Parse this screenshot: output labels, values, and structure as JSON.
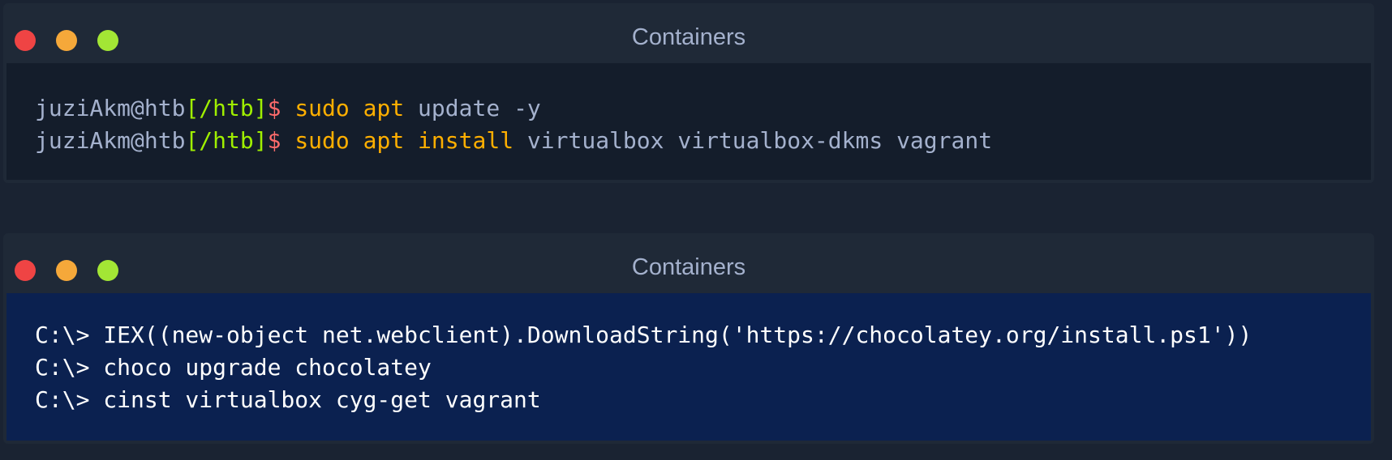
{
  "windows": [
    {
      "title": "Containers",
      "lines": [
        {
          "user": "juziAkm@htb",
          "path": "[/htb]",
          "dollar": "$",
          "cmd": "sudo",
          "arg1": "apt",
          "arg2": "update",
          "rest": "-y"
        },
        {
          "user": "juziAkm@htb",
          "path": "[/htb]",
          "dollar": "$",
          "cmd": "sudo",
          "arg1": "apt",
          "arg2": "install",
          "rest": "virtualbox virtualbox-dkms vagrant"
        }
      ]
    },
    {
      "title": "Containers",
      "lines": [
        "C:\\> IEX((new-object net.webclient).DownloadString('https://chocolatey.org/install.ps1'))",
        "C:\\> choco upgrade chocolatey",
        "C:\\> cinst virtualbox cyg-get vagrant"
      ]
    }
  ],
  "colors": {
    "background": "#1a2332",
    "titlebar": "#1f2937",
    "bash_terminal": "#141d2b",
    "powershell_terminal": "#0b2150",
    "close_dot": "#ef4444",
    "minimize_dot": "#f5a83a",
    "maximize_dot": "#a3e635",
    "prompt_path": "#9fef00",
    "prompt_dollar": "#ff6b6b",
    "keyword": "#ffaf00",
    "text": "#a4b1cd"
  },
  "icons": {
    "close": "close-dot-icon",
    "minimize": "minimize-dot-icon",
    "maximize": "maximize-dot-icon"
  }
}
